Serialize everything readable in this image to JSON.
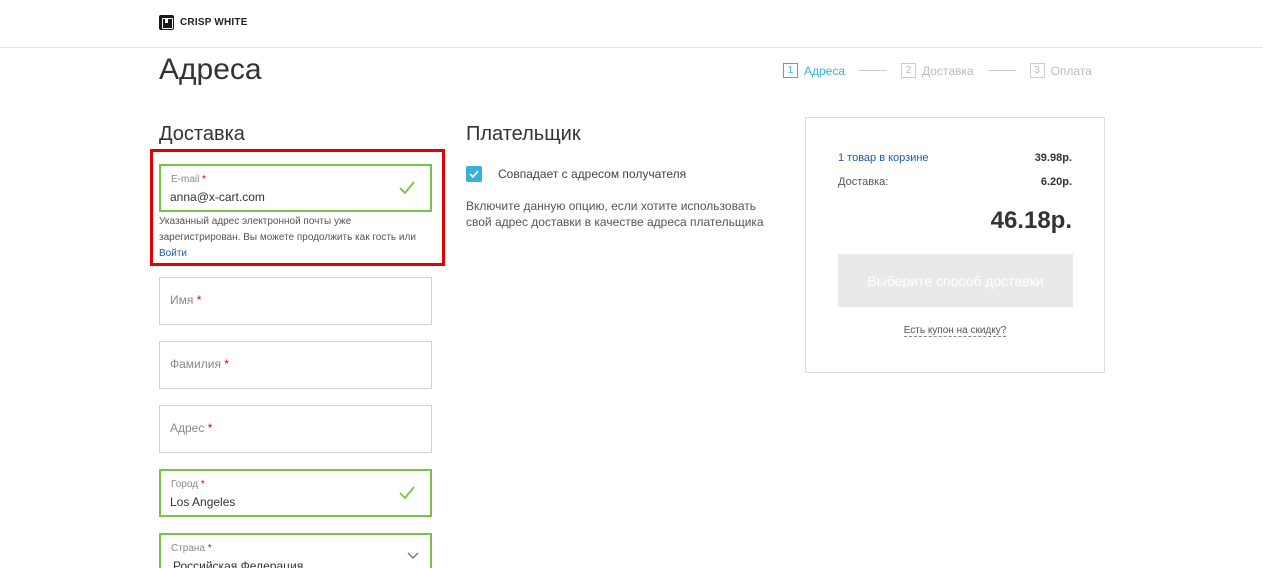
{
  "header": {
    "brand": "CRISP WHITE"
  },
  "page": {
    "title": "Адреса"
  },
  "steps": [
    {
      "num": "1",
      "label": "Адреса",
      "active": true
    },
    {
      "num": "2",
      "label": "Доставка",
      "active": false
    },
    {
      "num": "3",
      "label": "Оплата",
      "active": false
    }
  ],
  "shipping": {
    "title": "Доставка",
    "email": {
      "label": "E-mail",
      "required": "*",
      "value": "anna@x-cart.com",
      "message": "Указанный адрес электронной почты уже зарегистрирован. Вы можете продолжить как гость или",
      "login_link": "Войти"
    },
    "first_name": {
      "placeholder": "Имя",
      "required": "*"
    },
    "last_name": {
      "placeholder": "Фамилия",
      "required": "*"
    },
    "address": {
      "placeholder": "Адрес",
      "required": "*"
    },
    "city": {
      "label": "Город",
      "required": "*",
      "value": "Los Angeles"
    },
    "country": {
      "label": "Страна",
      "required": "*",
      "value": "Российская Федерация"
    }
  },
  "payer": {
    "title": "Плательщик",
    "same_address_label": "Совпадает с адресом получателя",
    "hint": "Включите данную опцию, если хотите использовать свой адрес доставки в качестве адреса плательщика"
  },
  "summary": {
    "cart_link": "1 товар в корзине",
    "cart_value": "39.98р.",
    "shipping_label": "Доставка:",
    "shipping_value": "6.20р.",
    "total": "46.18р.",
    "button_label": "Выберите способ доставки",
    "coupon_link": "Есть купон на скидку?"
  },
  "colors": {
    "accent": "#3ab0d8",
    "valid": "#7bc147",
    "required": "#d0021b",
    "highlight": "#e10000",
    "link": "#1f5aa8"
  }
}
